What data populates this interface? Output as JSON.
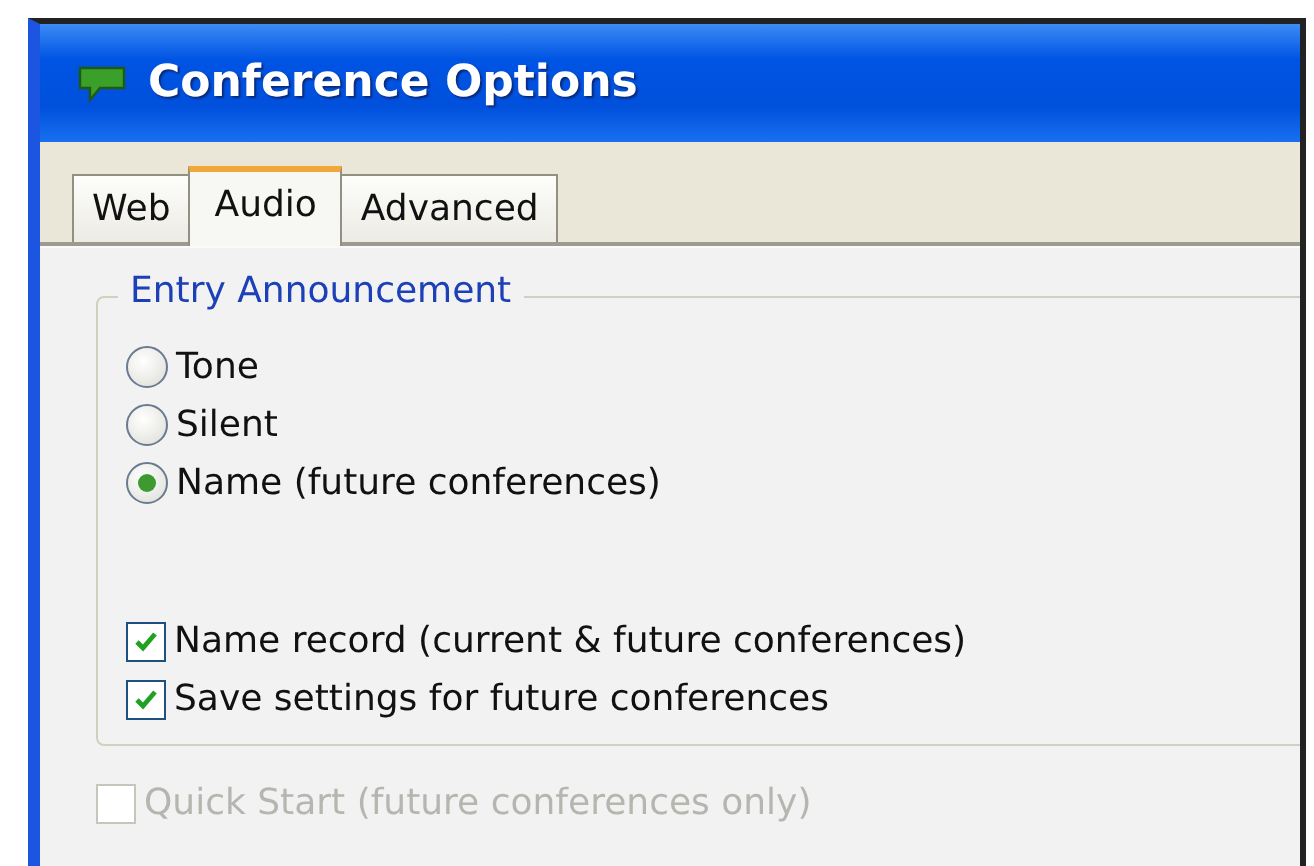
{
  "window": {
    "title": "Conference Options"
  },
  "tabs": [
    {
      "label": "Web",
      "selected": false
    },
    {
      "label": "Audio",
      "selected": true
    },
    {
      "label": "Advanced",
      "selected": false
    }
  ],
  "group": {
    "title": "Entry Announcement",
    "radios": [
      {
        "label": "Tone",
        "selected": false
      },
      {
        "label": "Silent",
        "selected": false
      },
      {
        "label": "Name (future conferences)",
        "selected": true
      }
    ],
    "checkboxes": [
      {
        "label": "Name record (current & future conferences)",
        "checked": true,
        "disabled": false
      },
      {
        "label": "Save settings for future conferences",
        "checked": true,
        "disabled": false
      }
    ]
  },
  "extra_checkboxes": [
    {
      "label": "Quick Start (future conferences only)",
      "checked": false,
      "disabled": true
    }
  ]
}
